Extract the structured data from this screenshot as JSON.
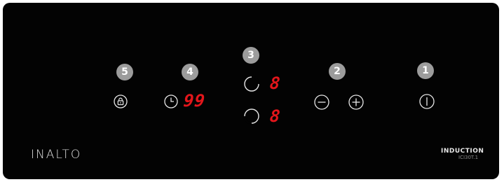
{
  "brand": {
    "name": "INALTO"
  },
  "model": {
    "name": "INDUCTION",
    "code": "ICI30T.1"
  },
  "badges": {
    "one": "1",
    "two": "2",
    "three": "3",
    "four": "4",
    "five": "5"
  },
  "displays": {
    "timer": "99",
    "zone_top": "8",
    "zone_bottom": "8"
  },
  "colors": {
    "panel": "#030303",
    "badge": "#9c9c9c",
    "led": "#e3161b",
    "icon": "#e8e8e8"
  },
  "icons": [
    "lock-icon",
    "timer-icon",
    "zone-top-icon",
    "zone-bottom-icon",
    "minus-icon",
    "plus-icon",
    "power-icon"
  ]
}
